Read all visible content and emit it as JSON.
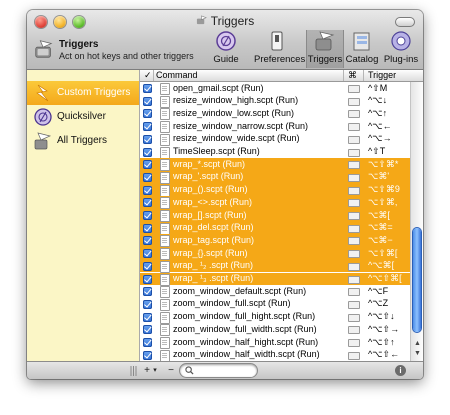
{
  "window": {
    "title": "Triggers"
  },
  "app": {
    "name": "Triggers",
    "description": "Act on hot keys and other triggers"
  },
  "toolbar": {
    "buttons": [
      {
        "label": "Guide",
        "icon": "guide-icon"
      },
      {
        "label": "Preferences",
        "icon": "preferences-switch-icon"
      },
      {
        "label": "Triggers",
        "icon": "triggers-icon",
        "active": true
      },
      {
        "label": "Catalog",
        "icon": "catalog-icon"
      },
      {
        "label": "Plug-ins",
        "icon": "plugins-icon"
      }
    ]
  },
  "sidebar": {
    "items": [
      {
        "label": "Custom Triggers",
        "icon": "lightning-icon",
        "selected": true
      },
      {
        "label": "Quicksilver",
        "icon": "quicksilver-icon",
        "selected": false
      },
      {
        "label": "All Triggers",
        "icon": "all-triggers-icon",
        "selected": false
      }
    ]
  },
  "table": {
    "columns": {
      "enabled": "✓",
      "command": "Command",
      "keys": "⌘",
      "trigger": "Trigger"
    },
    "rows": [
      {
        "name": "open_gmail.scpt (Run)",
        "trigger": "^⇧M",
        "highlighted": false
      },
      {
        "name": "resize_window_high.scpt (Run)",
        "trigger": "^⌥↓",
        "highlighted": false
      },
      {
        "name": "resize_window_low.scpt (Run)",
        "trigger": "^⌥↑",
        "highlighted": false
      },
      {
        "name": "resize_window_narrow.scpt (Run)",
        "trigger": "^⌥←",
        "highlighted": false
      },
      {
        "name": "resize_window_wide.scpt (Run)",
        "trigger": "^⌥→",
        "highlighted": false
      },
      {
        "name": "TimeSleep.scpt (Run)",
        "trigger": "^⇧T",
        "highlighted": false
      },
      {
        "name": "wrap_*.scpt (Run)",
        "trigger": "⌥⇧⌘*",
        "highlighted": true
      },
      {
        "name": "wrap_'.scpt (Run)",
        "trigger": "⌥⌘'",
        "highlighted": true
      },
      {
        "name": "wrap_().scpt (Run)",
        "trigger": "⌥⇧⌘9",
        "highlighted": true
      },
      {
        "name": "wrap_<>.scpt (Run)",
        "trigger": "⌥⇧⌘,",
        "highlighted": true
      },
      {
        "name": "wrap_[].scpt (Run)",
        "trigger": "⌥⌘[",
        "highlighted": true
      },
      {
        "name": "wrap_del.scpt (Run)",
        "trigger": "⌥⌘=",
        "highlighted": true
      },
      {
        "name": "wrap_tag.scpt (Run)",
        "trigger": "⌥⌘−",
        "highlighted": true
      },
      {
        "name": "wrap_{}.scpt (Run)",
        "trigger": "⌥⇧⌘[",
        "highlighted": true
      },
      {
        "name": "wrap_  ¹₂  .scpt (Run)",
        "trigger": "^⌥⌘[",
        "highlighted": true
      },
      {
        "name": "wrap_  ¹₃  .scpt (Run)",
        "trigger": "^⌥⇧⌘[",
        "highlighted": true
      },
      {
        "name": "zoom_window_default.scpt (Run)",
        "trigger": "^⌥F",
        "highlighted": false
      },
      {
        "name": "zoom_window_full.scpt (Run)",
        "trigger": "^⌥Z",
        "highlighted": false
      },
      {
        "name": "zoom_window_full_hight.scpt (Run)",
        "trigger": "^⌥⇧↓",
        "highlighted": false
      },
      {
        "name": "zoom_window_full_width.scpt (Run)",
        "trigger": "^⌥⇧→",
        "highlighted": false
      },
      {
        "name": "zoom_window_half_hight.scpt (Run)",
        "trigger": "^⌥⇧↑",
        "highlighted": false
      },
      {
        "name": "zoom_window_half_width.scpt (Run)",
        "trigger": "^⌥⇧←",
        "highlighted": false
      }
    ]
  },
  "bottombar": {
    "add_label": "+",
    "add_menu_label": "▾",
    "remove_label": "−",
    "info_label": "i",
    "search_placeholder": ""
  },
  "colors": {
    "highlight": "#f5a817",
    "sidebar_bg": "#fbf6c6",
    "selection": "#f4a81b"
  }
}
